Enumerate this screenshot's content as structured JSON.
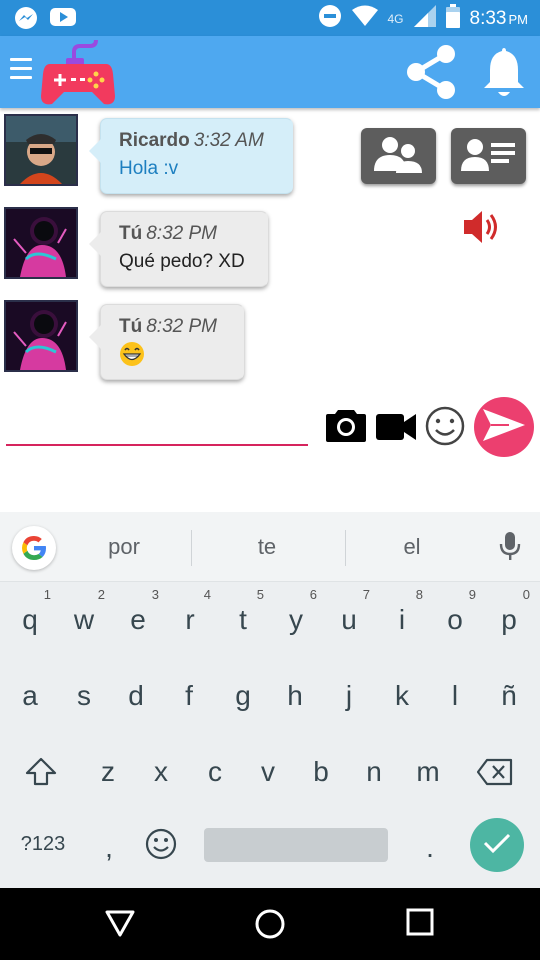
{
  "status_bar": {
    "time": "8:33",
    "ampm": "PM",
    "network": "4G",
    "icons": [
      "messenger-icon",
      "youtube-icon",
      "do-not-disturb-icon",
      "wifi-icon",
      "signal-icon",
      "battery-icon"
    ]
  },
  "app_bar": {
    "icons": [
      "menu-icon",
      "gamepad-logo-icon",
      "share-icon",
      "bell-icon"
    ]
  },
  "chat": {
    "messages": [
      {
        "author": "Ricardo",
        "time": "3:32 AM",
        "text": "Hola :v",
        "style": "incoming"
      },
      {
        "author": "Tú",
        "time": "8:32 PM",
        "text": "Qué pedo? XD",
        "style": "outgoing"
      },
      {
        "author": "Tú",
        "time": "8:32 PM",
        "text": "",
        "emoji": "grinning-face-icon",
        "style": "outgoing"
      }
    ],
    "buttons": [
      "group-contacts-icon",
      "contact-card-icon",
      "speaker-icon"
    ]
  },
  "composer": {
    "input_value": "",
    "tools": [
      "camera-icon",
      "video-camera-icon",
      "emoji-icon",
      "send-icon"
    ]
  },
  "keyboard": {
    "suggestions": [
      "por",
      "te",
      "el"
    ],
    "row1": [
      {
        "k": "q",
        "n": "1"
      },
      {
        "k": "w",
        "n": "2"
      },
      {
        "k": "e",
        "n": "3"
      },
      {
        "k": "r",
        "n": "4"
      },
      {
        "k": "t",
        "n": "5"
      },
      {
        "k": "y",
        "n": "6"
      },
      {
        "k": "u",
        "n": "7"
      },
      {
        "k": "i",
        "n": "8"
      },
      {
        "k": "o",
        "n": "9"
      },
      {
        "k": "p",
        "n": "0"
      }
    ],
    "row2": [
      "a",
      "s",
      "d",
      "f",
      "g",
      "h",
      "j",
      "k",
      "l",
      "ñ"
    ],
    "row3": [
      "z",
      "x",
      "c",
      "v",
      "b",
      "n",
      "m"
    ],
    "symbols_label": "?123",
    "comma": ",",
    "period": "."
  },
  "colors": {
    "status_bar": "#2b8fd8",
    "app_bar": "#4ea8f0",
    "accent": "#ec3f6f",
    "incoming_bubble": "#d5eef9",
    "outgoing_bubble": "#ececec",
    "enter_key": "#4db6a3"
  }
}
